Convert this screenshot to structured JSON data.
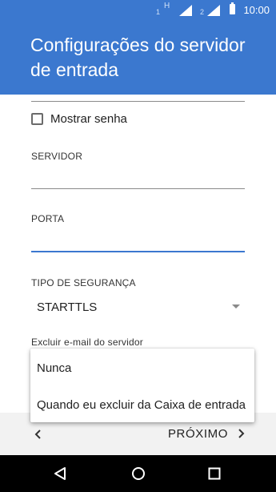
{
  "status_bar": {
    "sim1": "1",
    "network_type": "H",
    "sim2": "2",
    "time": "10:00"
  },
  "app_bar": {
    "title": "Configurações do servidor de entrada"
  },
  "form": {
    "show_password_label": "Mostrar senha",
    "show_password_checked": false,
    "server_label": "SERVIDOR",
    "server_value": "",
    "port_label": "PORTA",
    "port_value": "",
    "security_label": "TIPO DE SEGURANÇA",
    "security_value": "STARTTLS",
    "delete_email_label": "Excluir e-mail do servidor"
  },
  "dropdown": {
    "options": [
      "Nunca",
      "Quando eu excluir da Caixa de entrada"
    ]
  },
  "navigation": {
    "next_label": "PRÓXIMO"
  },
  "colors": {
    "accent": "#3b78cf",
    "status_bar": "#3b78cf",
    "system_nav": "#000000",
    "footer_bg": "#f2f2f2"
  },
  "icons": [
    "signal-icon",
    "battery-icon",
    "checkbox-icon",
    "dropdown-arrow-icon",
    "chevron-left-icon",
    "chevron-right-icon",
    "nav-back-icon",
    "nav-home-icon",
    "nav-recents-icon"
  ]
}
